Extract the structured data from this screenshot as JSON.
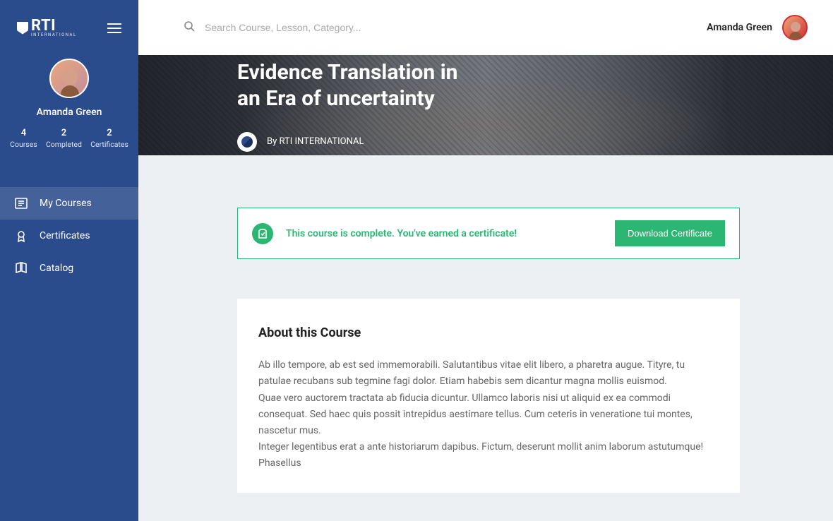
{
  "brand": {
    "name": "RTI",
    "subtitle": "INTERNATIONAL"
  },
  "search": {
    "placeholder": "Search Course, Lesson, Category..."
  },
  "user": {
    "name": "Amanda Green"
  },
  "profile": {
    "name": "Amanda Green",
    "stats": [
      {
        "value": "4",
        "label": "Courses"
      },
      {
        "value": "2",
        "label": "Completed"
      },
      {
        "value": "2",
        "label": "Certificates"
      }
    ]
  },
  "nav": {
    "items": [
      {
        "label": "My Courses",
        "active": true
      },
      {
        "label": "Certificates",
        "active": false
      },
      {
        "label": "Catalog",
        "active": false
      }
    ]
  },
  "course": {
    "title": "Evidence Translation in\nan Era of uncertainty",
    "byline_prefix": "By",
    "byline_org": "RTI INTERNATIONAL"
  },
  "certificate": {
    "message": "This course is complete. You've earned a certificate!",
    "button": "Download Certificate"
  },
  "about": {
    "heading": "About this Course",
    "body": "Ab illo tempore, ab est sed immemorabili. Salutantibus vitae elit libero, a pharetra augue. Tityre, tu patulae recubans sub tegmine fagi dolor. Etiam habebis sem dicantur magna mollis euismod.\nQuae vero auctorem tractata ab fiducia dicuntur. Ullamco laboris nisi ut aliquid ex ea commodi consequat. Sed haec quis possit intrepidus aestimare tellus. Cum ceteris in veneratione tui montes, nascetur mus.\nInteger legentibus erat a ante historiarum dapibus. Fictum, deserunt mollit anim laborum astutumque! Phasellus"
  },
  "colors": {
    "primary": "#2b4c8c",
    "success": "#2bb673"
  }
}
